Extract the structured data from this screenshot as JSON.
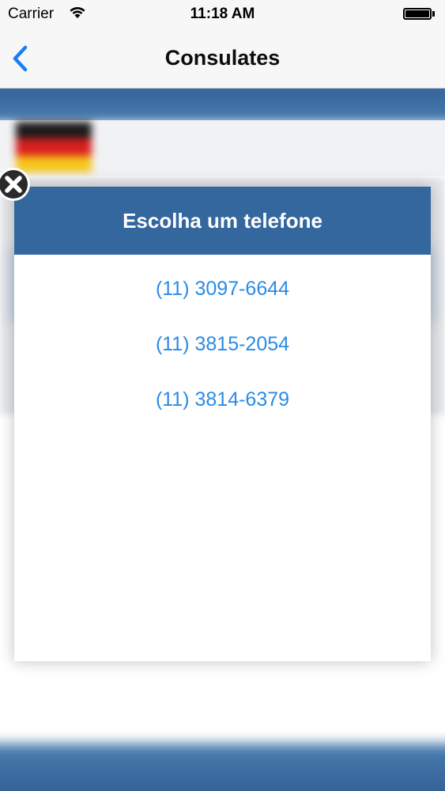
{
  "status_bar": {
    "carrier": "Carrier",
    "time": "11:18 AM",
    "wifi_icon": "wifi-icon",
    "battery_icon": "battery-icon"
  },
  "nav_bar": {
    "title": "Consulates",
    "back_icon": "chevron-left-icon"
  },
  "dialog": {
    "title": "Escolha um telefone",
    "close_icon": "close-icon",
    "phones": [
      "(11) 3097-6644",
      "(11) 3815-2054",
      "(11) 3814-6379"
    ]
  },
  "colors": {
    "accent": "#2a8be6",
    "header_blue": "#33679e",
    "nav_back": "#1a7ef0"
  }
}
